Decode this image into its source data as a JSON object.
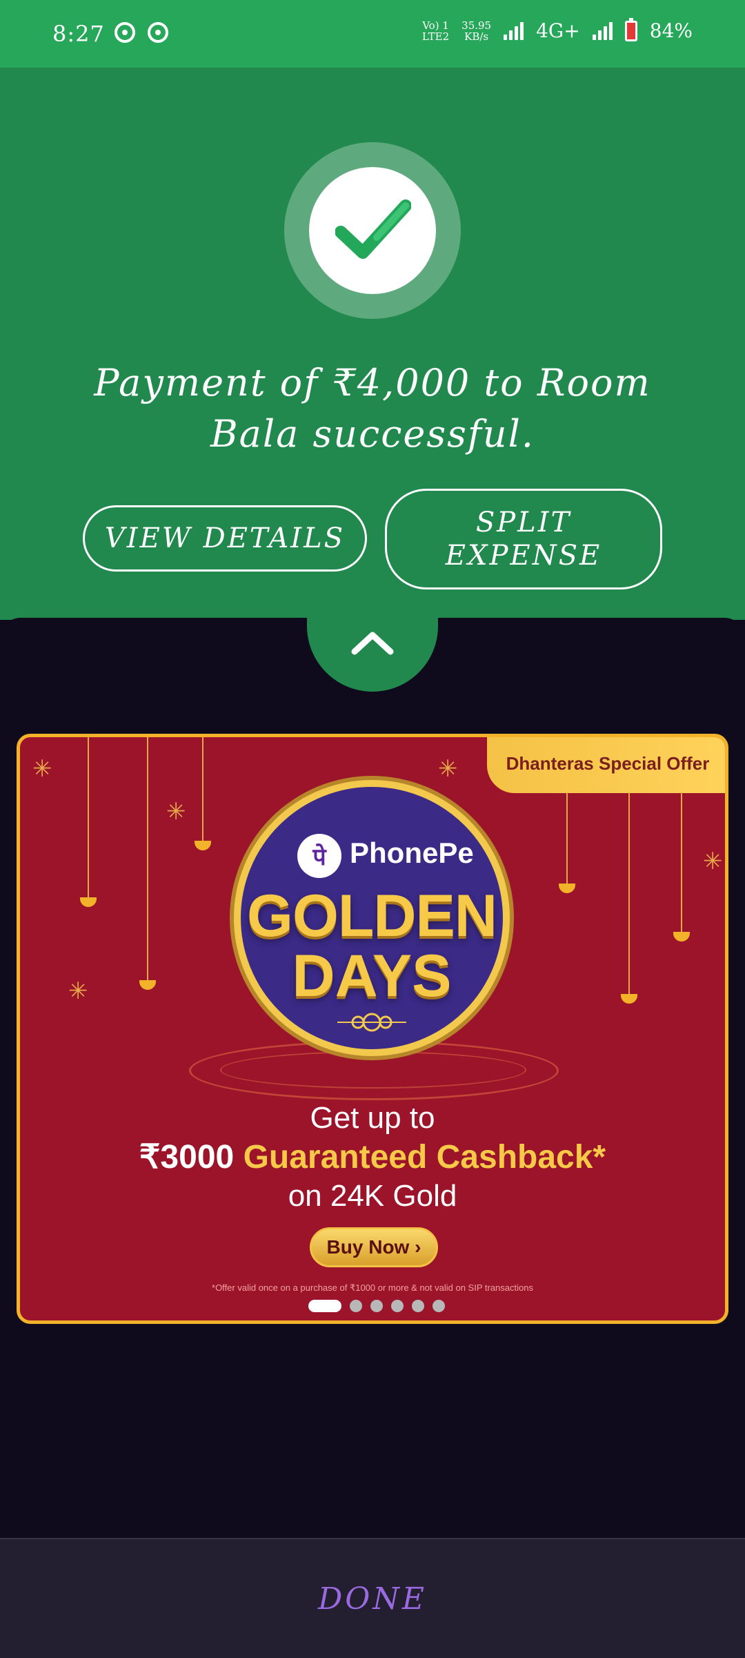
{
  "status_bar": {
    "time": "8:27",
    "network_label": "Vo) 1\nLTE2",
    "speed_value": "35.95",
    "speed_unit": "KB/s",
    "network_type": "4G+",
    "battery": "84%"
  },
  "payment": {
    "message": "Payment of ₹4,000 to Room Bala successful.",
    "view_details_label": "VIEW DETAILS",
    "split_expense_label": "SPLIT EXPENSE"
  },
  "banner": {
    "tag": "Dhanteras Special Offer",
    "brand": "PhonePe",
    "title_line1": "GOLDEN",
    "title_line2": "DAYS",
    "offer_line1": "Get up to",
    "offer_amount": "₹3000",
    "offer_highlight": "Guaranteed Cashback*",
    "offer_line3": "on 24K Gold",
    "cta": "Buy Now ›",
    "fine_print": "*Offer valid once on a purchase of ₹1000 or more & not valid on SIP transactions",
    "carousel_total": 6,
    "carousel_active": 1
  },
  "footer": {
    "done_label": "DONE"
  },
  "colors": {
    "success_green": "#21894d",
    "dark_bg": "#0f0b1d",
    "banner_red": "#9c1429",
    "gold": "#f7c948",
    "done_purple": "#9a6be0"
  }
}
